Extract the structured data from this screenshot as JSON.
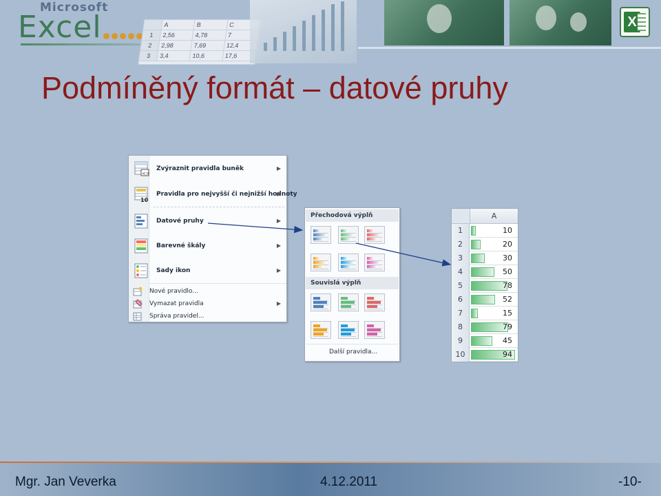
{
  "banner": {
    "brand_small": "Microsoft",
    "brand_big": "Excel",
    "mini_sheet": {
      "cols": [
        "A",
        "B",
        "C"
      ],
      "rows": [
        {
          "n": "1",
          "a": "2,56",
          "b": "4,78",
          "c": "7"
        },
        {
          "n": "2",
          "a": "2,98",
          "b": "7,69",
          "c": "12,4"
        },
        {
          "n": "3",
          "a": "3,4",
          "b": "10,6",
          "c": "17,6"
        }
      ]
    },
    "icon": "excel-app-icon"
  },
  "title": "Podmíněný formát – datové pruhy",
  "cf_menu": {
    "items": [
      {
        "label": "Zvýraznit pravidla buněk",
        "icon": "highlight-rules-icon",
        "submenu": true
      },
      {
        "label": "Pravidla pro nejvyšší či nejnižší hodnoty",
        "icon": "top-bottom-rules-icon",
        "submenu": true
      },
      {
        "label": "Datové pruhy",
        "icon": "data-bars-icon",
        "submenu": true
      },
      {
        "label": "Barevné škály",
        "icon": "color-scales-icon",
        "submenu": true
      },
      {
        "label": "Sady ikon",
        "icon": "icon-sets-icon",
        "submenu": true
      }
    ],
    "small_items": [
      {
        "label": "Nové pravidlo...",
        "icon": "new-rule-icon",
        "submenu": false
      },
      {
        "label": "Vymazat pravidla",
        "icon": "clear-rules-icon",
        "submenu": true
      },
      {
        "label": "Správa pravidel...",
        "icon": "manage-rules-icon",
        "submenu": false
      }
    ]
  },
  "gallery": {
    "gradient_header": "Přechodová výplň",
    "solid_header": "Souvislá výplň",
    "more": "Další pravidla...",
    "colors": [
      "#4f81bd",
      "#63be7b",
      "#e06666",
      "#f3a31b",
      "#1f9ce0",
      "#d660a8"
    ]
  },
  "sheet": {
    "column": "A",
    "rows": [
      {
        "n": "1",
        "v": 10
      },
      {
        "n": "2",
        "v": 20
      },
      {
        "n": "3",
        "v": 30
      },
      {
        "n": "4",
        "v": 50
      },
      {
        "n": "5",
        "v": 78
      },
      {
        "n": "6",
        "v": 52
      },
      {
        "n": "7",
        "v": 15
      },
      {
        "n": "8",
        "v": 79
      },
      {
        "n": "9",
        "v": 45
      },
      {
        "n": "10",
        "v": 94
      }
    ],
    "bar_color": "#63be7b"
  },
  "footer": {
    "author": "Mgr. Jan Veverka",
    "date": "4.12.2011",
    "page": "-10-"
  }
}
